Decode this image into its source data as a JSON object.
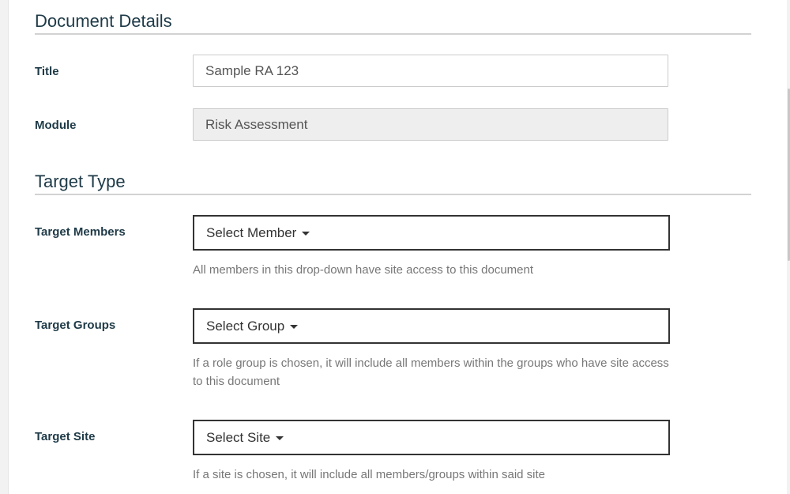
{
  "document_details": {
    "heading": "Document Details",
    "title_label": "Title",
    "title_value": "Sample RA 123",
    "module_label": "Module",
    "module_value": "Risk Assessment"
  },
  "target_type": {
    "heading": "Target Type",
    "members": {
      "label": "Target Members",
      "button": "Select Member",
      "help": "All members in this drop-down have site access to this document"
    },
    "groups": {
      "label": "Target Groups",
      "button": "Select Group",
      "help": "If a role group is chosen, it will include all members within the groups who have site access to this document"
    },
    "site": {
      "label": "Target Site",
      "button": "Select Site",
      "help": "If a site is chosen, it will include all members/groups within said site"
    }
  },
  "icons": {
    "dropdown": "caret-down-icon"
  },
  "colors": {
    "heading": "#1e3a47",
    "label": "#1e3a47",
    "help_text": "#777777",
    "select_border": "#333333",
    "disabled_bg": "#eeeeee"
  }
}
